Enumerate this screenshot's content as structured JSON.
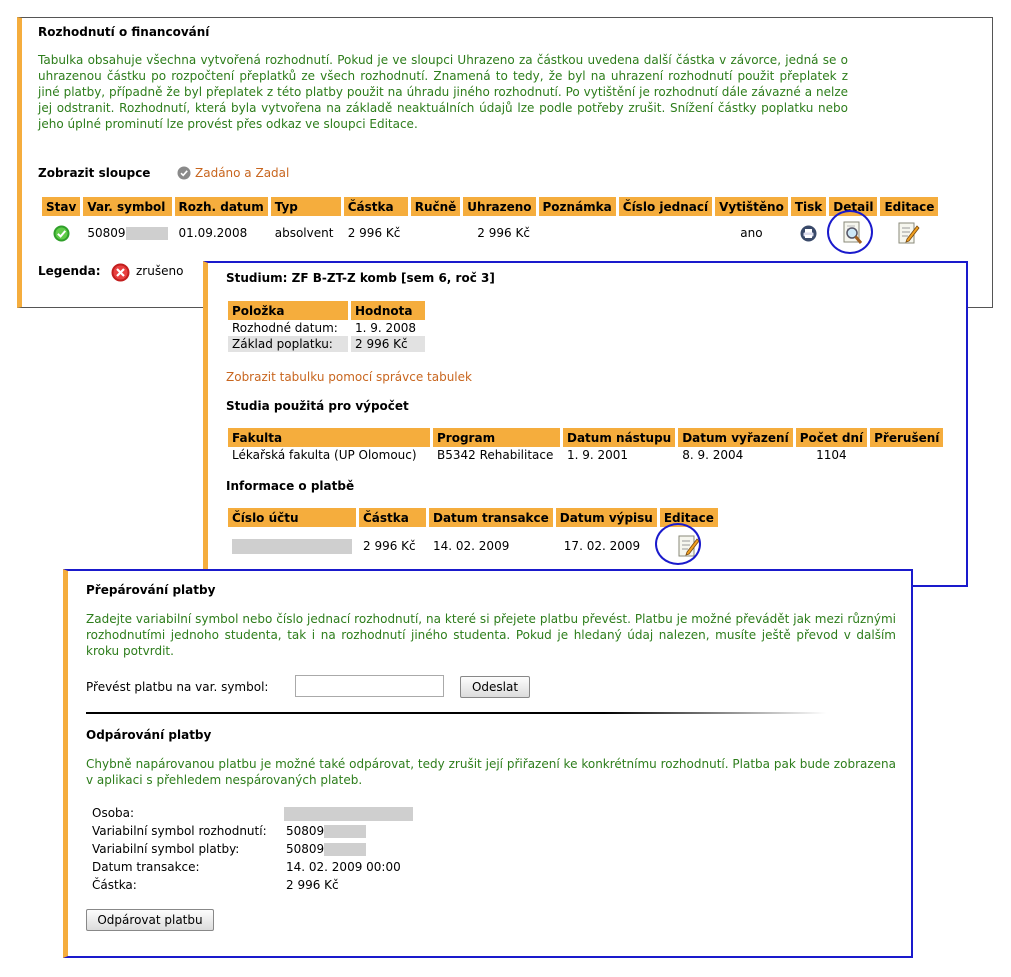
{
  "p1": {
    "title": "Rozhodnutí o financování",
    "info": "Tabulka obsahuje všechna vytvořená rozhodnutí. Pokud je ve sloupci Uhrazeno za částkou uvedena další částka v závorce, jedná se o uhrazenou částku po rozpočtení přeplatků ze všech rozhodnutí. Znamená to tedy, že byl na uhrazení rozhodnutí použit přeplatek z jiné platby, případně že byl přeplatek z této platby použit na úhradu jiného rozhodnutí. Po vytištění je rozhodnutí dále závazné a nelze jej odstranit. Rozhodnutí, která byla vytvořena na základě neaktuálních údajů lze podle potřeby zrušit. Snížení částky poplatku nebo jeho úplné prominutí lze provést přes odkaz ve sloupci Editace.",
    "columns_label": "Zobrazit sloupce",
    "columns_link": "Zadáno a Zadal",
    "headers": [
      "Stav",
      "Var. symbol",
      "Rozh. datum",
      "Typ",
      "Částka",
      "Ručně",
      "Uhrazeno",
      "Poznámka",
      "Číslo jednací",
      "Vytištěno",
      "Tisk",
      "Detail",
      "Editace"
    ],
    "row": {
      "var_symbol": "50809",
      "date": "01.09.2008",
      "type": "absolvent",
      "amount": "2 996 Kč",
      "paid": "2 996 Kč",
      "printed": "ano"
    },
    "legend_label": "Legenda:",
    "legend_text": "zrušeno"
  },
  "p2": {
    "title": "Studium: ZF B-ZT-Z komb [sem 6, roč 3]",
    "item_headers": [
      "Položka",
      "Hodnota"
    ],
    "items": [
      [
        "Rozhodné datum:",
        "1. 9. 2008"
      ],
      [
        "Základ poplatku:",
        "2 996 Kč"
      ]
    ],
    "link": "Zobrazit tabulku pomocí správce tabulek",
    "studies_title": "Studia použitá pro výpočet",
    "study_headers": [
      "Fakulta",
      "Program",
      "Datum nástupu",
      "Datum vyřazení",
      "Počet dní",
      "Přerušení"
    ],
    "study_row": [
      "Lékařská fakulta (UP Olomouc)",
      "B5342 Rehabilitace",
      "1. 9. 2001",
      "8. 9. 2004",
      "1104",
      ""
    ],
    "payment_title": "Informace o platbě",
    "payment_headers": [
      "Číslo účtu",
      "Částka",
      "Datum transakce",
      "Datum výpisu",
      "Editace"
    ],
    "payment_row": {
      "amount": "2 996 Kč",
      "transaction": "14. 02. 2009",
      "statement": "17. 02. 2009"
    }
  },
  "p3": {
    "title": "Přepárování platby",
    "info": "Zadejte variabilní symbol nebo číslo jednací rozhodnutí, na které si přejete platbu převést. Platbu je možné převádět jak mezi různými rozhodnutími jednoho studenta, tak i na rozhodnutí jiného studenta. Pokud je hledaný údaj nalezen, musíte ještě převod v dalším kroku potvrdit.",
    "transfer_label": "Převést platbu na var. symbol:",
    "transfer_value": "",
    "submit_label": "Odeslat",
    "unpair_title": "Odpárování platby",
    "unpair_info": "Chybně napárovanou platbu je možné také odpárovat, tedy zrušit její přiřazení ke konkrétnímu rozhodnutí. Platba pak bude zobrazena v aplikaci s přehledem nespárovaných plateb.",
    "details": [
      {
        "label": "Osoba:",
        "value": ""
      },
      {
        "label": "Variabilní symbol rozhodnutí:",
        "value": "50809"
      },
      {
        "label": "Variabilní symbol platby:",
        "value": "50809"
      },
      {
        "label": "Datum transakce:",
        "value": "14. 02. 2009 00:00"
      },
      {
        "label": "Částka:",
        "value": "2 996 Kč"
      }
    ],
    "unpair_button": "Odpárovat platbu"
  },
  "icons": {
    "ok": "check-circle-icon",
    "cancel": "x-circle-icon",
    "print": "printer-icon",
    "detail": "magnifier-document-icon",
    "edit": "pencil-document-icon",
    "column": "gear-circle-icon"
  }
}
